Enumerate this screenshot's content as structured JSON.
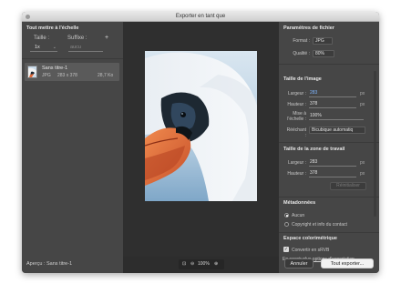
{
  "window": {
    "title": "Exporter en tant que"
  },
  "left": {
    "section_title": "Tout mettre à l'échelle",
    "size_label": "Taille :",
    "suffix_label": "Suffixe :",
    "add_symbol": "+",
    "scale_value": "1x",
    "suffix_placeholder": "aucu",
    "asset": {
      "name": "Sans titre-1",
      "format": "JPG",
      "dimensions": "283 x 378",
      "filesize": "28,7 Ko"
    },
    "preview_label": "Aperçu : Sans titre-1"
  },
  "zoom": {
    "value": "100%"
  },
  "right": {
    "file_settings": {
      "title": "Paramètres de fichier",
      "format_label": "Format :",
      "format_value": "JPG",
      "quality_label": "Qualité :",
      "quality_value": "80%"
    },
    "image_size": {
      "title": "Taille de l'image",
      "width_label": "Largeur :",
      "width_value": "283",
      "height_label": "Hauteur :",
      "height_value": "378",
      "unit": "px",
      "scale_label_1": "Mise à",
      "scale_label_2": "l'échelle :",
      "scale_value": "100%",
      "resample_label": "Rééchant :",
      "resample_value": "Bicubique automatiq"
    },
    "canvas_size": {
      "title": "Taille de la zone de travail",
      "width_label": "Largeur :",
      "width_value": "283",
      "height_label": "Hauteur :",
      "height_value": "378",
      "unit": "px",
      "reset_label": "Réinitialiser"
    },
    "metadata": {
      "title": "Métadonnées",
      "option_none": "Aucun",
      "option_copyright": "Copyright et info du contact"
    },
    "color_space": {
      "title": "Espace colorimétrique",
      "convert_label": "Convertir en sRVB",
      "learn_text": "En savoir plus",
      "learn_link": "options d'exportation."
    }
  },
  "buttons": {
    "cancel": "Annuler",
    "export": "Tout exporter..."
  }
}
